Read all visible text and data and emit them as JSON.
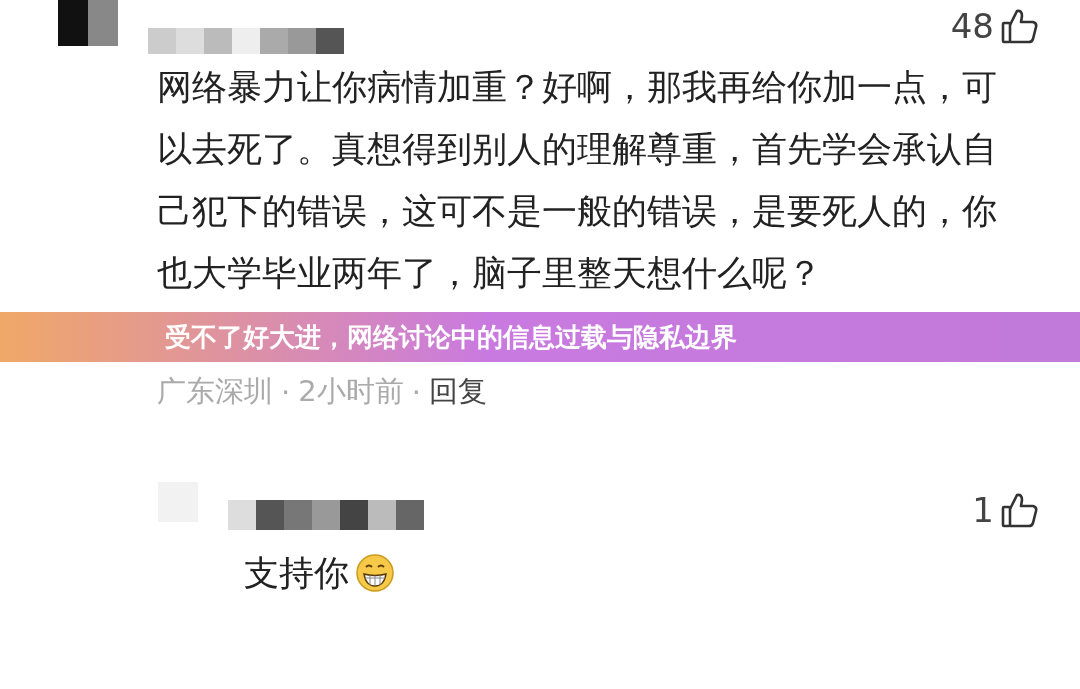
{
  "comments": [
    {
      "likes": "48",
      "text": "网络暴力让你病情加重？好啊，那我再给你加一点，可以去死了。真想得到别人的理解尊重，首先学会承认自己犯下的错误，这可不是一般的错误，是要死人的，你也大学毕业两年了，脑子里整天想什么呢？",
      "location": "广东深圳",
      "separator": "·",
      "time": "2小时前",
      "reply": "回复",
      "kind": "plain"
    },
    {
      "likes": "1",
      "text": "支持你",
      "kind": "grin"
    }
  ],
  "banner": {
    "title": "受不了好大进，网络讨论中的信息过载与隐私边界"
  }
}
